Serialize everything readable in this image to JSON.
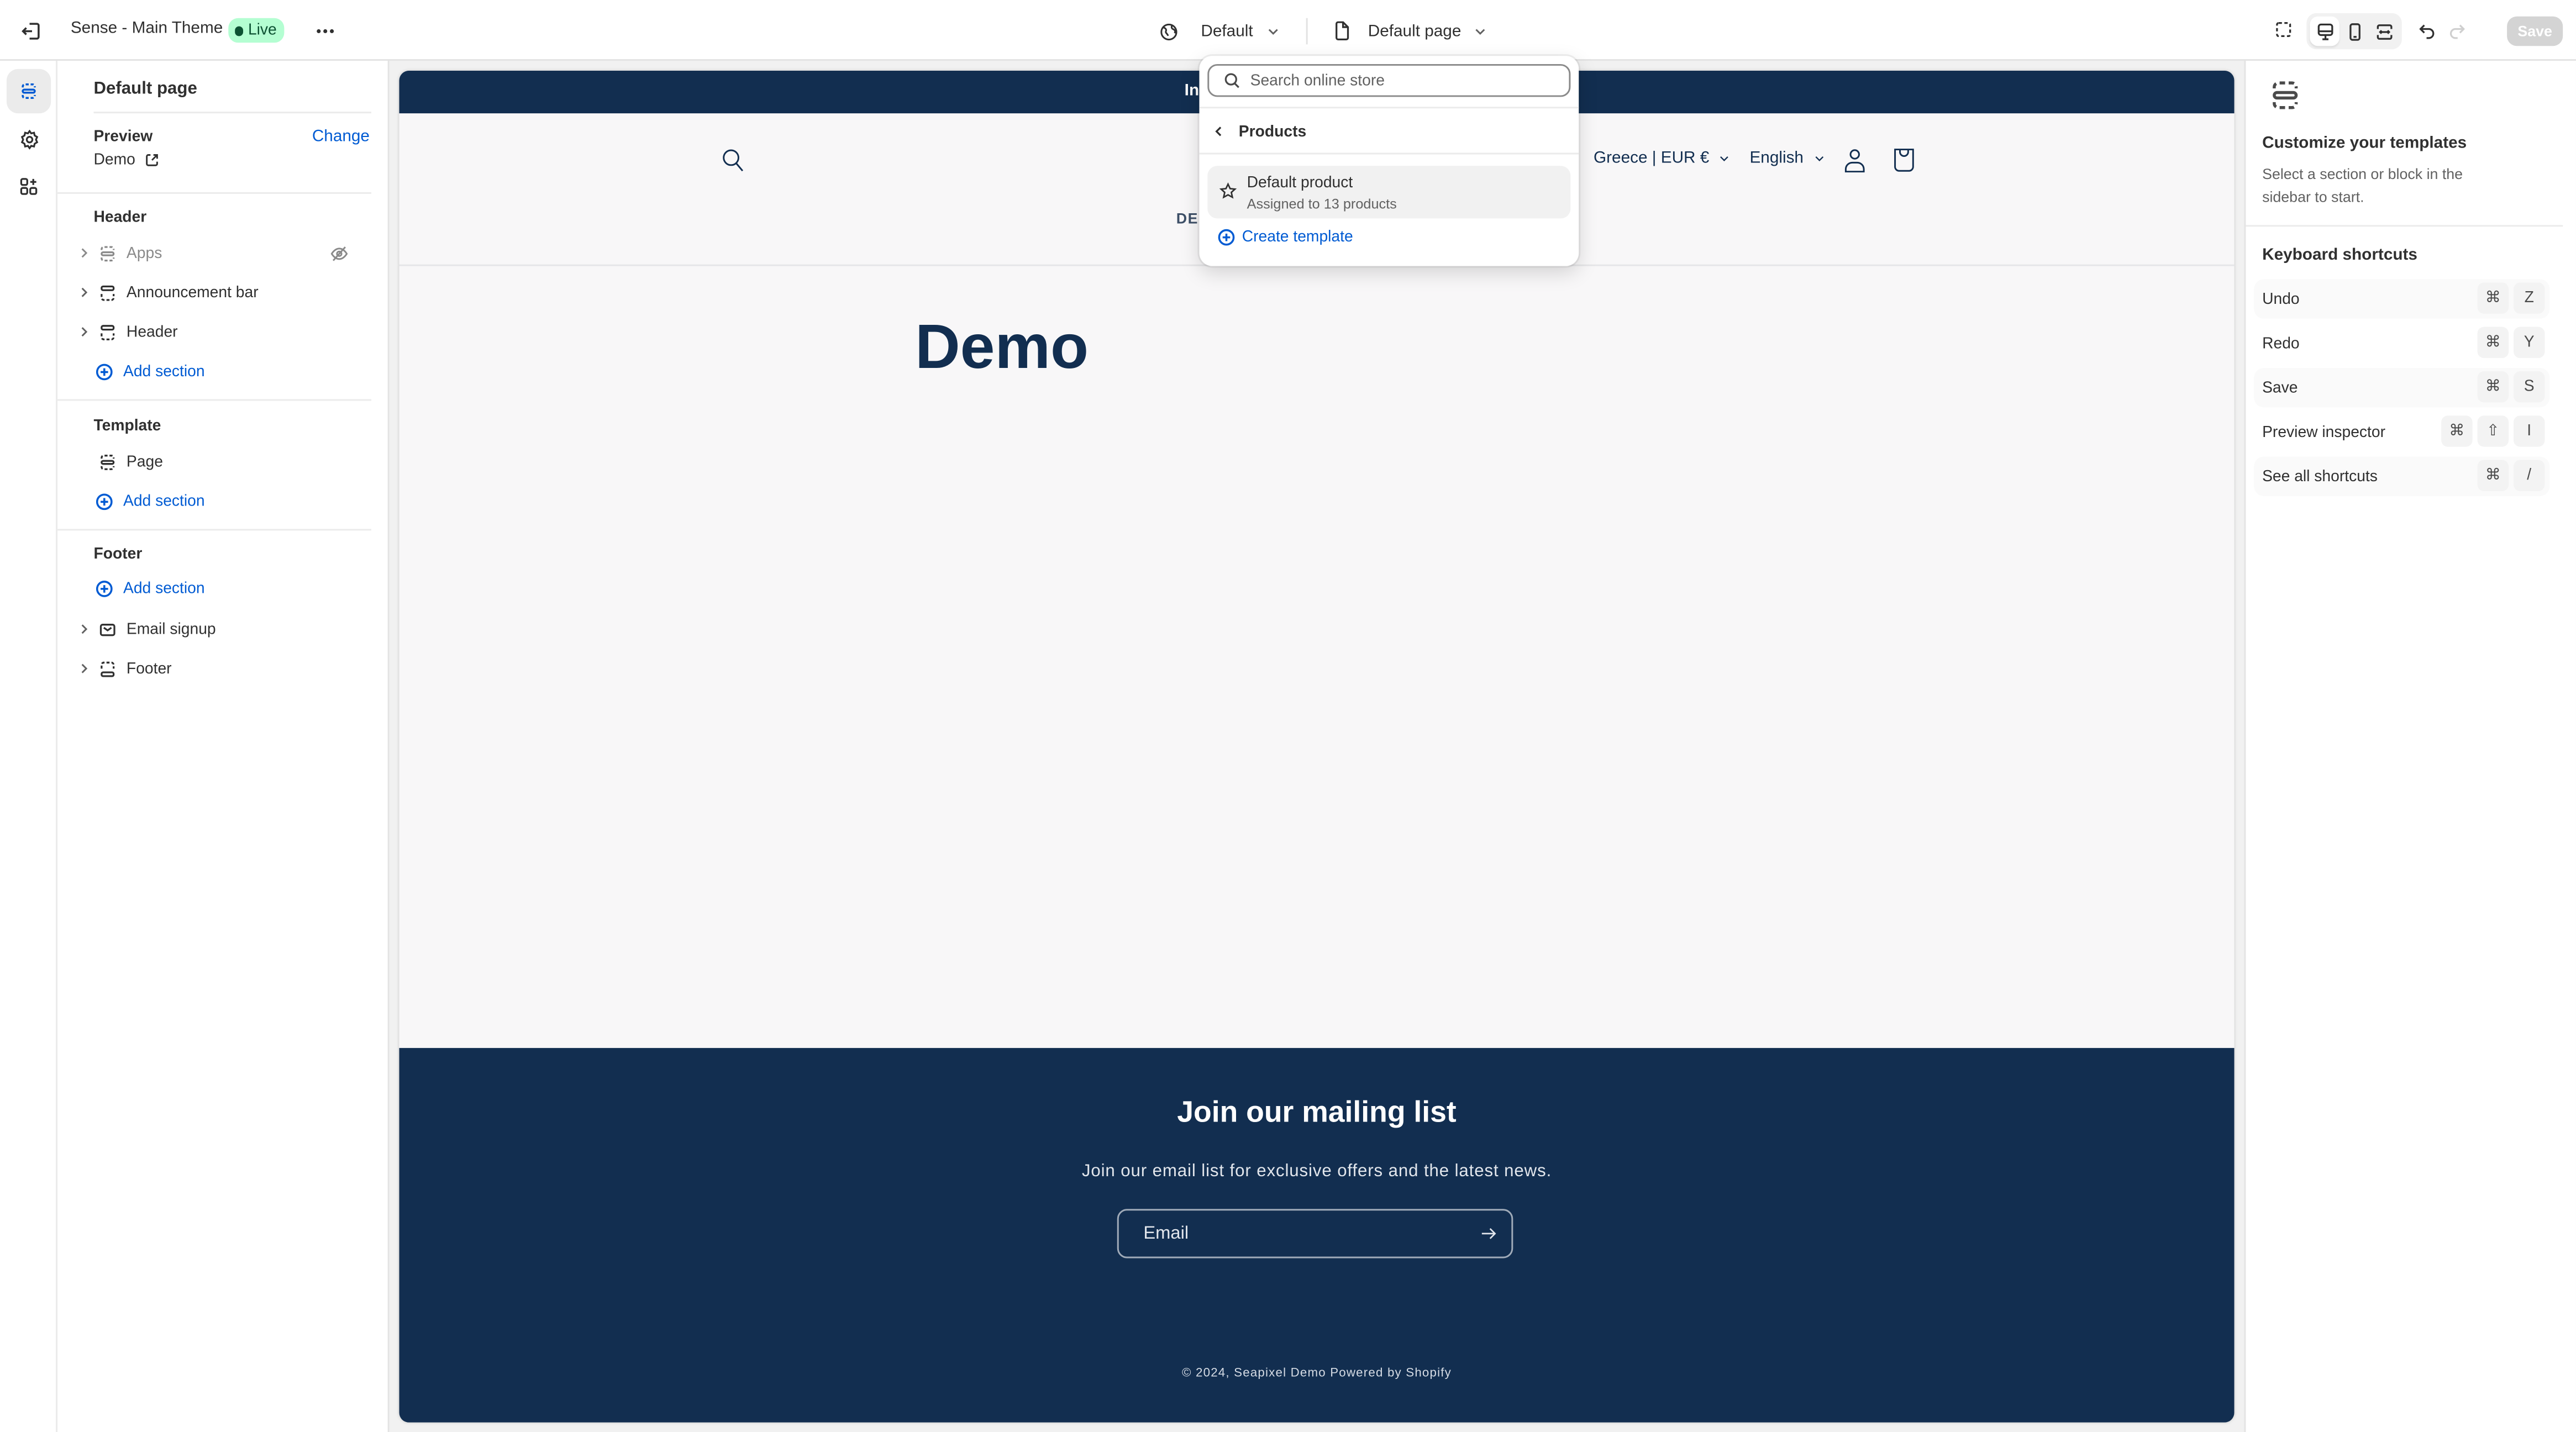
{
  "topbar": {
    "theme_title": "Sense - Main Theme",
    "status_badge": "Live",
    "locale_dropdown": "Default",
    "page_dropdown": "Default page",
    "save_label": "Save",
    "icons": [
      "exit-icon",
      "more-icon",
      "globe-icon",
      "page-icon",
      "chevron-down-icon",
      "inspector-icon",
      "desktop-icon",
      "mobile-icon",
      "fullwidth-icon",
      "undo-icon",
      "redo-icon"
    ]
  },
  "rail": {
    "items": [
      {
        "name": "sections",
        "icon": "sections-icon",
        "active": true
      },
      {
        "name": "theme-settings",
        "icon": "gear-icon",
        "active": false
      },
      {
        "name": "app-embeds",
        "icon": "apps-add-icon",
        "active": false
      }
    ]
  },
  "sidebar": {
    "title": "Default page",
    "preview_label": "Preview",
    "change_label": "Change",
    "preview_value": "Demo",
    "groups": {
      "header": {
        "label": "Header",
        "items": [
          {
            "label": "Apps",
            "hidden": true
          },
          {
            "label": "Announcement bar",
            "hidden": false
          },
          {
            "label": "Header",
            "hidden": false
          }
        ],
        "add_label": "Add section"
      },
      "template": {
        "label": "Template",
        "items": [
          {
            "label": "Page"
          }
        ],
        "add_label": "Add section"
      },
      "footer": {
        "label": "Footer",
        "add_label": "Add section",
        "items": [
          {
            "label": "Email signup"
          },
          {
            "label": "Footer"
          }
        ]
      }
    }
  },
  "popover": {
    "search_placeholder": "Search online store",
    "search_value": "",
    "back_label": "Products",
    "items": [
      {
        "title": "Default product",
        "subtitle": "Assigned to 13 products"
      }
    ],
    "create_label": "Create template"
  },
  "store": {
    "announcement_text": "In",
    "locale": "Greece | EUR €",
    "language": "English",
    "nav_partial": "DE",
    "page_title": "Demo",
    "newsletter": {
      "title": "Join our mailing list",
      "subtitle": "Join our email list for exclusive offers and the latest news.",
      "email_placeholder": "Email"
    },
    "copyright": "© 2024, Seapixel Demo Powered by Shopify",
    "colors": {
      "brand_navy": "#122e50",
      "background": "#f8f7f8"
    }
  },
  "right_panel": {
    "title": "Customize your templates",
    "description": "Select a section or block in the sidebar to start.",
    "shortcuts_title": "Keyboard shortcuts",
    "shortcuts": [
      {
        "label": "Undo",
        "keys": [
          "⌘",
          "Z"
        ]
      },
      {
        "label": "Redo",
        "keys": [
          "⌘",
          "Y"
        ]
      },
      {
        "label": "Save",
        "keys": [
          "⌘",
          "S"
        ]
      },
      {
        "label": "Preview inspector",
        "keys": [
          "⌘",
          "⇧",
          "I"
        ]
      },
      {
        "label": "See all shortcuts",
        "keys": [
          "⌘",
          "/"
        ]
      }
    ]
  },
  "colors": {
    "accent": "#005bd3",
    "live_badge_bg": "#b4fed2",
    "live_badge_text": "#0c5132"
  }
}
